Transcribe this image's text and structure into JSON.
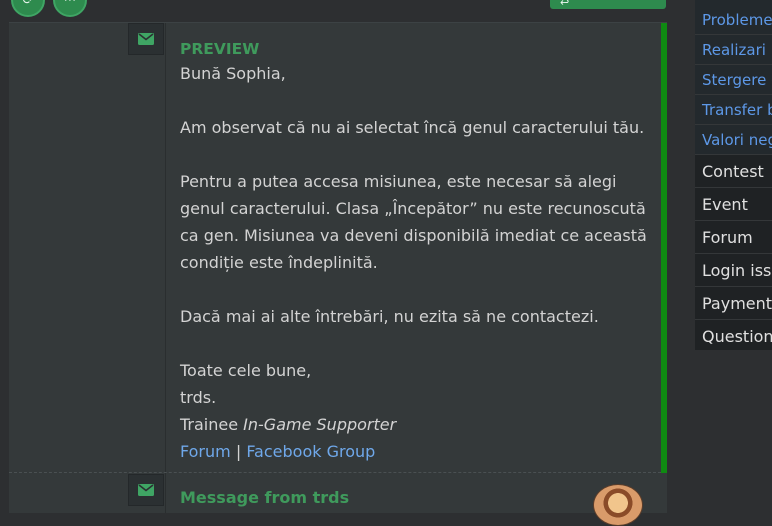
{
  "toolbar": {
    "button1_icon": "refresh-icon",
    "button2_icon": "share-icon",
    "right_button_icon": "reply-icon"
  },
  "message": {
    "title": "PREVIEW",
    "greeting": "Bună Sophia,",
    "paragraph1": "Am observat că nu ai selectat încă genul caracterului tău.",
    "paragraph2": "Pentru a putea accesa misiunea, este necesar să alegi genul caracterului. Clasa „Începător” nu este recunoscută ca gen. Misiunea va deveni disponibilă imediat ce această condiție este îndeplinită.",
    "paragraph3": "Dacă mai ai alte întrebări, nu ezita să ne contactezi.",
    "closing": "Toate cele bune,",
    "signature_name": "trds.",
    "role_prefix": "Trainee",
    "role_title": "In-Game Supporter",
    "link_forum": "Forum",
    "separator": "|",
    "link_facebook": "Facebook Group"
  },
  "next_message": {
    "title": "Message from trds"
  },
  "sidebar": {
    "links": [
      "Probleme",
      "Realizari I",
      "Stergere c",
      "Transfer b",
      "Valori neg"
    ],
    "categories": [
      "Contest",
      "Event",
      "Forum",
      "Login issu",
      "Payment",
      "Question"
    ]
  },
  "colors": {
    "accent_green": "#3f9a5c",
    "bar_green": "#0f8a12",
    "link_blue": "#6fa8ea"
  }
}
